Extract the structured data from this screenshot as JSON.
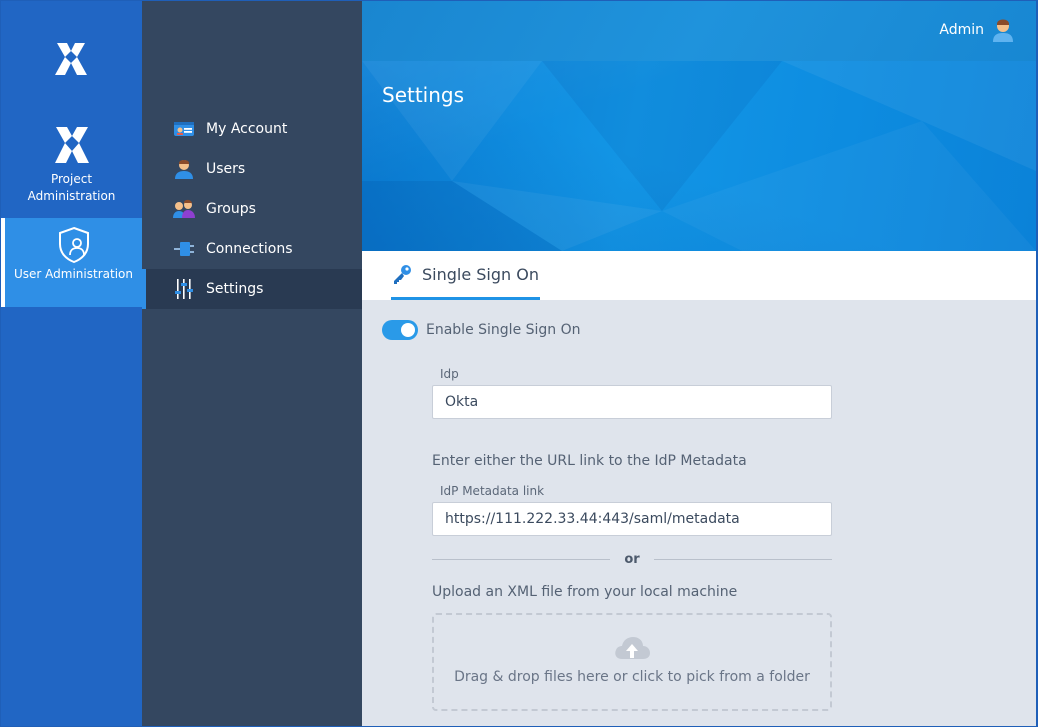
{
  "rail": {
    "project_label_line1": "Project",
    "project_label_line2": "Administration",
    "user_admin_label": "User Administration"
  },
  "nav": {
    "items": [
      {
        "label": "My Account",
        "icon": "id-card-icon"
      },
      {
        "label": "Users",
        "icon": "user-icon"
      },
      {
        "label": "Groups",
        "icon": "group-icon"
      },
      {
        "label": "Connections",
        "icon": "connection-icon"
      },
      {
        "label": "Settings",
        "icon": "sliders-icon",
        "active": true
      }
    ]
  },
  "header": {
    "user_name": "Admin",
    "page_title": "Settings"
  },
  "tabs": [
    {
      "label": "Single Sign On",
      "icon": "key-icon",
      "active": true
    }
  ],
  "sso": {
    "enable_label": "Enable Single Sign On",
    "enabled": true,
    "idp_label": "Idp",
    "idp_value": "Okta",
    "url_hint": "Enter either the URL link to the IdP Metadata",
    "metadata_label": "IdP Metadata link",
    "metadata_value": "https://111.222.33.44:443/saml/metadata",
    "or_text": "or",
    "upload_hint": "Upload an XML file from your local machine",
    "drop_text": "Drag & drop files here or click to pick from a folder"
  },
  "colors": {
    "rail_bg": "#2166c4",
    "nav_bg": "#344760",
    "accent": "#2f8fe6",
    "main_bg": "#dfe4ec"
  }
}
